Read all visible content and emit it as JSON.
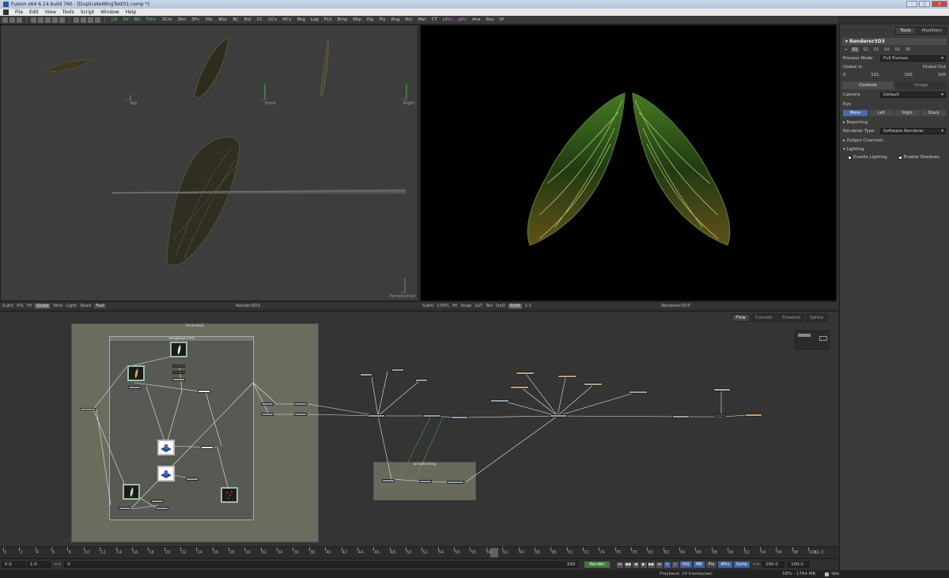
{
  "window": {
    "title": "Fusion x64 6.14 build 760 - [DuplicateWingTest01.comp *]",
    "buttons": {
      "minimize": "–",
      "maximize": "□",
      "close": "x"
    }
  },
  "menu": [
    "File",
    "Edit",
    "View",
    "Tools",
    "Script",
    "Window",
    "Help"
  ],
  "toolbar": {
    "tools": [
      "LD",
      "SV",
      "BG",
      "Txt+",
      "3Cm",
      "3Im",
      "3Fn",
      "3SL",
      "Blur",
      "BC",
      "Bol",
      "CC",
      "CCv",
      "HCv",
      "Mrg",
      "Log",
      "FLU",
      "Bmp",
      "BSp",
      "Elp",
      "Ply",
      "Rng",
      "Rct",
      "Mat",
      "CT",
      "pEm",
      "pRn",
      "Ana",
      "Rsz",
      "Xf"
    ],
    "green_tools": [
      "LD",
      "SV",
      "BG",
      "Txt+"
    ],
    "pink_tools": [
      "pEm",
      "pRn"
    ]
  },
  "left_viewer": {
    "labels": {
      "top": "Top",
      "front": "Front",
      "right": "Right",
      "perspective": "Perspective"
    },
    "bar": {
      "subview": "SubV",
      "zoom": "6%",
      "fit": "Fit",
      "quad": "Quad",
      "wire": "Wire",
      "light": "Light",
      "shad": "Shad",
      "fast": "Fast",
      "title": "Render3D3"
    }
  },
  "right_viewer": {
    "bar": {
      "subview": "SubV",
      "zoom": "139%",
      "fit": "Fit",
      "snap": "Snap",
      "lut": "LUT",
      "roi": "RoI",
      "dod": "DoD",
      "smr": "SmR",
      "ratio": "1:1",
      "title": "Renderer3D3"
    }
  },
  "inspector": {
    "tabs": [
      "Tools",
      "Modifiers"
    ],
    "active_tab": "Tools",
    "tool_name": "Renderer3D3",
    "slots": [
      "S1",
      "S2",
      "S3",
      "S4",
      "S5",
      "S6"
    ],
    "active_slot": "S1",
    "process_mode_label": "Process Mode",
    "process_mode_value": "Full Frames",
    "global_in_label": "Global In",
    "global_out_label": "Global Out",
    "global_in_value": "0",
    "global_mid_value": "101",
    "global_end_value": "100",
    "global_out_value": "100",
    "sub_tabs": [
      "Controls",
      "Image"
    ],
    "active_sub_tab": "Controls",
    "camera_label": "Camera",
    "camera_value": "Default",
    "eye_label": "Eye",
    "eye_buttons": [
      "Mono",
      "Left",
      "Right",
      "Stack"
    ],
    "active_eye": "Mono",
    "reporting": "Reporting",
    "renderer_type_label": "Renderer Type",
    "renderer_type_value": "Software Renderer",
    "output_channels": "Output Channels",
    "lighting": "Lighting",
    "enable_lighting": "Enable Lighting",
    "enable_shadows": "Enable Shadows"
  },
  "flow": {
    "tabs": [
      "Flow",
      "Console",
      "Timeline",
      "Spline"
    ],
    "active_tab": "Flow",
    "group_labels": {
      "outer": "Underlay1",
      "inner": "wingDuplicate",
      "bottom": "wingBlurring"
    }
  },
  "timeline": {
    "ticks": [
      "0",
      "2",
      "4",
      "6",
      "8",
      "10",
      "12",
      "14",
      "16",
      "18",
      "20",
      "22",
      "24",
      "26",
      "28",
      "30",
      "32",
      "34",
      "36",
      "38",
      "40",
      "42",
      "44",
      "46",
      "48",
      "50",
      "52",
      "54",
      "56",
      "58",
      "60",
      "62",
      "64",
      "66",
      "68",
      "70",
      "72",
      "74",
      "76",
      "78",
      "80",
      "82",
      "84",
      "86",
      "88",
      "90",
      "92",
      "94",
      "96",
      "98",
      "100"
    ],
    "current_frame": "61",
    "current_display": "61.0"
  },
  "transport": {
    "start": "0.0",
    "step": "1.0",
    "left_marker": "<<",
    "range_start": "0",
    "range_end": "100",
    "render": "Render",
    "hiq": "HiQ",
    "mb": "MB",
    "prx": "Prx",
    "aprx": "APrx",
    "some": "Some",
    "right_marker": ">>",
    "end": "100.0",
    "global_end": "100.0"
  },
  "status": {
    "playback": "Playback: 24 frames/sec",
    "memory": "58% - 1764 MB",
    "state": "Idle"
  },
  "colors": {
    "accent": "#4a69a8",
    "render_green": "#3f7a3b",
    "group_bg": "#6b6b5e",
    "wing_green": "#79d23e",
    "wing_gold": "#c9a640"
  }
}
